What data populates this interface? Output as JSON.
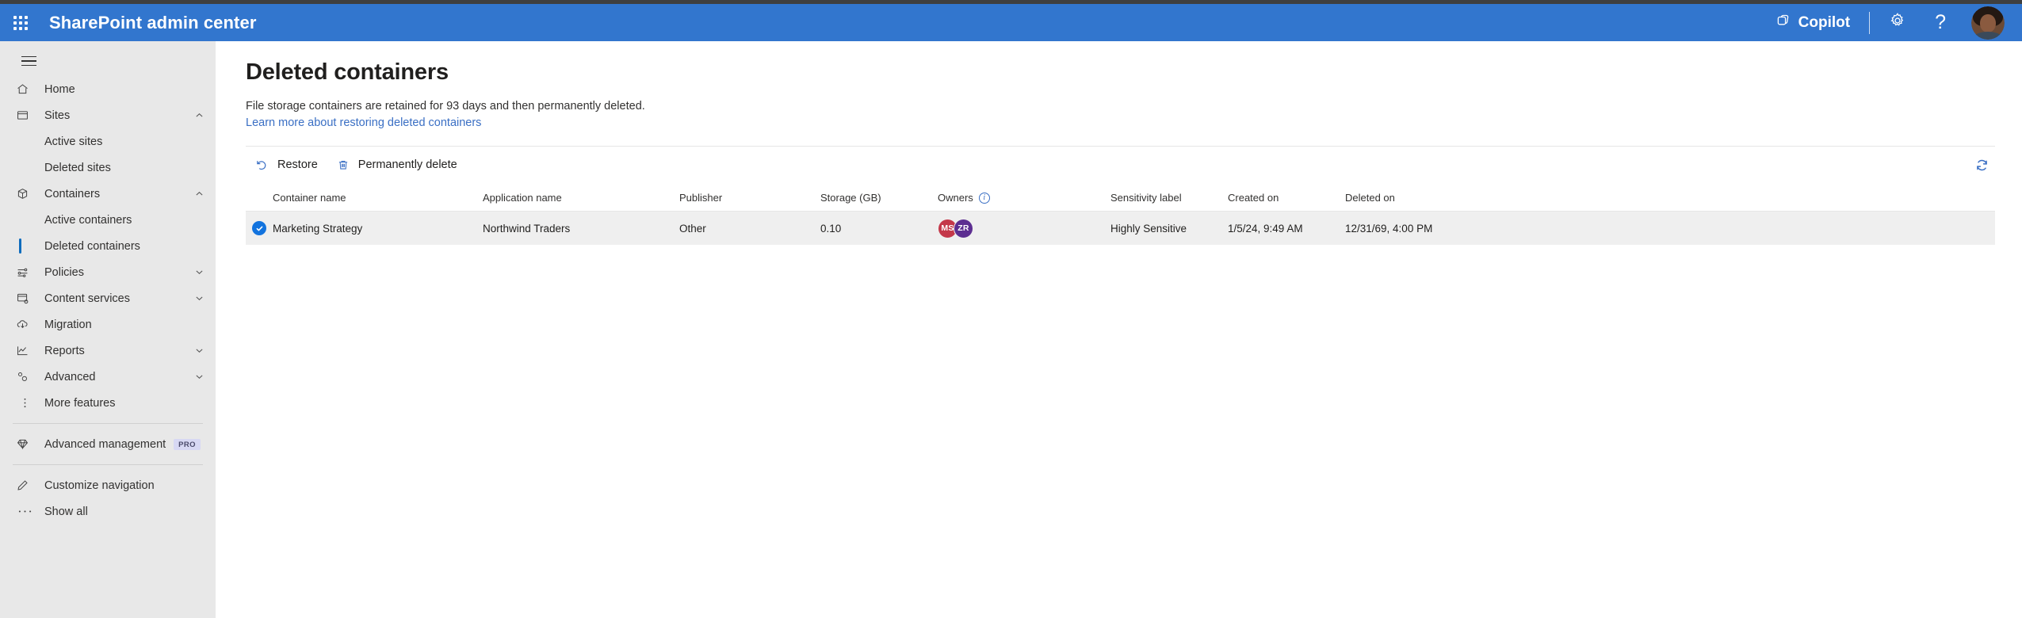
{
  "header": {
    "waffle_icon": "app-launcher-icon",
    "suite_title": "SharePoint admin center",
    "copilot_label": "Copilot",
    "copilot_icon": "copilot-icon",
    "settings_icon": "gear-icon",
    "help_icon": "question-mark-icon",
    "help_glyph": "?",
    "avatar_label": "account-avatar",
    "brand_color": "#3276ce"
  },
  "sidebar": {
    "hamburger_icon": "hamburger-menu-icon",
    "items": [
      {
        "label": "Home",
        "icon": "home-icon",
        "type": "item",
        "expandable": false
      },
      {
        "label": "Sites",
        "icon": "sites-icon",
        "type": "item",
        "expandable": true,
        "expanded": true
      },
      {
        "label": "Active sites",
        "icon": "",
        "type": "sub",
        "selected": false
      },
      {
        "label": "Deleted sites",
        "icon": "",
        "type": "sub",
        "selected": false
      },
      {
        "label": "Containers",
        "icon": "containers-icon",
        "type": "item",
        "expandable": true,
        "expanded": true
      },
      {
        "label": "Active containers",
        "icon": "",
        "type": "sub",
        "selected": false
      },
      {
        "label": "Deleted containers",
        "icon": "",
        "type": "sub",
        "selected": true
      },
      {
        "label": "Policies",
        "icon": "policies-icon",
        "type": "item",
        "expandable": true,
        "expanded": false
      },
      {
        "label": "Content services",
        "icon": "content-services-icon",
        "type": "item",
        "expandable": true,
        "expanded": false
      },
      {
        "label": "Migration",
        "icon": "migration-icon",
        "type": "item",
        "expandable": false
      },
      {
        "label": "Reports",
        "icon": "reports-icon",
        "type": "item",
        "expandable": true,
        "expanded": false
      },
      {
        "label": "Advanced",
        "icon": "advanced-icon",
        "type": "item",
        "expandable": true,
        "expanded": false
      },
      {
        "label": "More features",
        "icon": "more-features-icon",
        "type": "item",
        "expandable": false
      }
    ],
    "advanced_management": {
      "label": "Advanced management",
      "icon": "diamond-icon",
      "badge": "PRO",
      "badge_color": "#d7d8f3"
    },
    "customize_navigation": {
      "label": "Customize navigation",
      "icon": "pencil-icon"
    },
    "show_all": {
      "label": "Show all",
      "icon": "ellipsis-icon"
    },
    "selected_accent": "#0f6cbd"
  },
  "page": {
    "title": "Deleted containers",
    "description": "File storage containers are retained for 93 days and then permanently deleted.",
    "link": "Learn more about restoring deleted containers",
    "link_color": "#3a6fc4"
  },
  "commandbar": {
    "restore": {
      "label": "Restore",
      "icon": "restore-arrow-icon"
    },
    "permanently_delete": {
      "label": "Permanently delete",
      "icon": "trash-icon"
    },
    "refresh": {
      "label": "Refresh",
      "icon": "refresh-icon"
    }
  },
  "table": {
    "columns": [
      "Container name",
      "Application name",
      "Publisher",
      "Storage (GB)",
      "Owners",
      "Sensitivity label",
      "Created on",
      "Deleted on"
    ],
    "owners_info_icon": "info-icon",
    "rows": [
      {
        "selected": true,
        "container_name": "Marketing Strategy",
        "application_name": "Northwind Traders",
        "publisher": "Other",
        "storage_gb": "0.10",
        "owners": [
          {
            "initials": "MS",
            "color": "#c4384a"
          },
          {
            "initials": "ZR",
            "color": "#5c2e91"
          }
        ],
        "sensitivity_label": "Highly Sensitive",
        "created_on": "1/5/24, 9:49 AM",
        "deleted_on": "12/31/69, 4:00 PM"
      }
    ]
  }
}
